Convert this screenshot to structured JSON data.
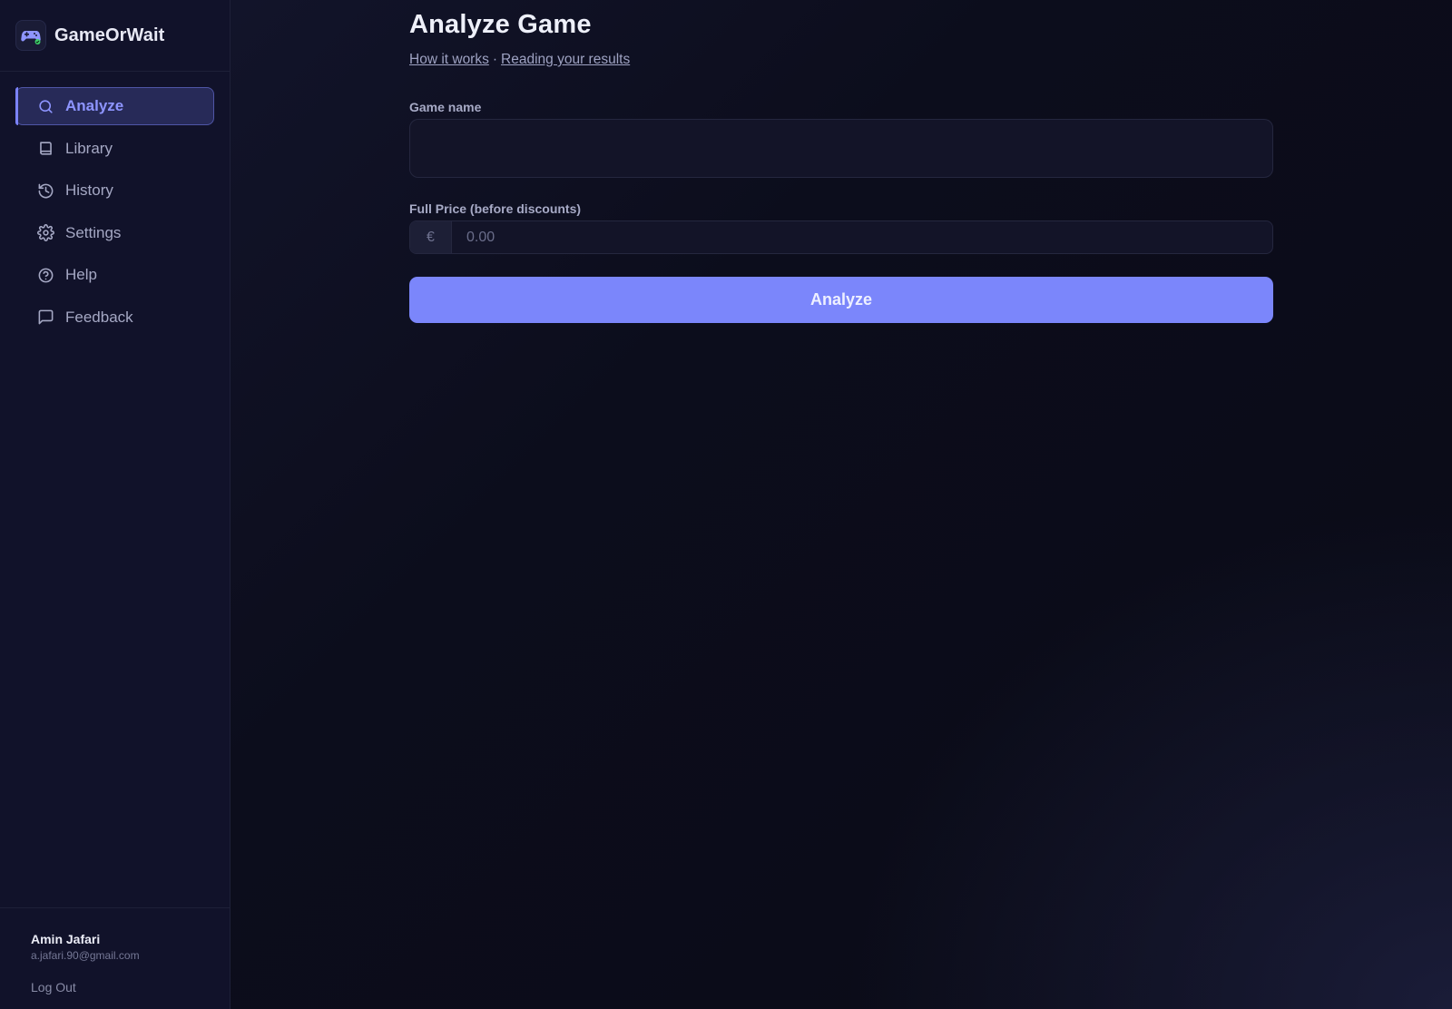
{
  "brand": {
    "name": "GameOrWait"
  },
  "sidebar": {
    "items": [
      {
        "label": "Analyze",
        "icon": "search-icon",
        "active": true
      },
      {
        "label": "Library",
        "icon": "book-icon",
        "active": false
      },
      {
        "label": "History",
        "icon": "history-icon",
        "active": false
      },
      {
        "label": "Settings",
        "icon": "gear-icon",
        "active": false
      },
      {
        "label": "Help",
        "icon": "help-circle-icon",
        "active": false
      },
      {
        "label": "Feedback",
        "icon": "message-square-icon",
        "active": false
      }
    ]
  },
  "user": {
    "name": "Amin Jafari",
    "email": "a.jafari.90@gmail.com",
    "logout_label": "Log Out"
  },
  "main": {
    "title": "Analyze Game",
    "links": {
      "how_it_works": "How it works",
      "separator": "·",
      "reading_results": "Reading your results"
    },
    "form": {
      "game_name_label": "Game name",
      "game_name_value": "",
      "price_label": "Full Price (before discounts)",
      "currency_symbol": "€",
      "price_placeholder": "0.00",
      "price_value": "",
      "submit_label": "Analyze"
    }
  },
  "colors": {
    "accent": "#7b86fb",
    "active_text": "#8e95ff",
    "sidebar_bg": "#11122a",
    "page_bg": "#0b0c18"
  }
}
